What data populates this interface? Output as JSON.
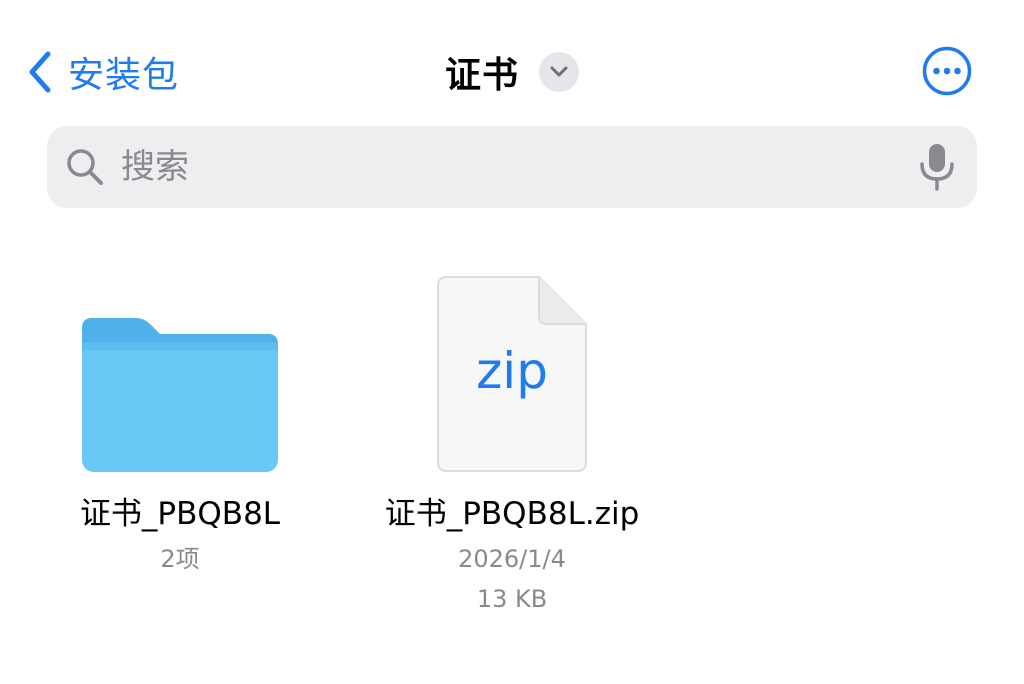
{
  "nav": {
    "back_label": "安装包",
    "title": "证书",
    "back_icon": "chevron-left-icon",
    "title_menu_icon": "chevron-down-icon",
    "more_icon": "ellipsis-circle-icon"
  },
  "search": {
    "placeholder": "搜索",
    "value": "",
    "search_icon": "magnifying-glass-icon",
    "mic_icon": "microphone-icon"
  },
  "items": [
    {
      "type": "folder",
      "icon": "folder-icon",
      "name": "证书_PBQB8L",
      "detail": "2项"
    },
    {
      "type": "file",
      "icon": "zip-file-icon",
      "extension": "zip",
      "name": "证书_PBQB8L.zip",
      "date": "2026/1/4",
      "size": "13 KB"
    }
  ],
  "colors": {
    "accent": "#1e7cf0",
    "folder_front": "#6ac8f6",
    "folder_back": "#4fb0ea",
    "secondary_text": "#8a8a8e",
    "search_bg": "#eeeef0"
  }
}
